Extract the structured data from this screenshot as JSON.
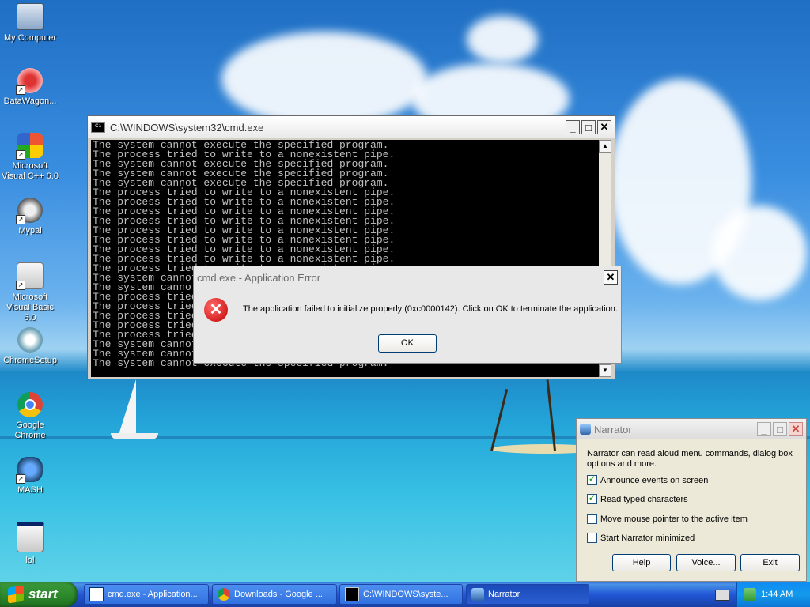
{
  "desktop_icons": [
    {
      "label": "My Computer",
      "icon": "computer-icon"
    },
    {
      "label": "DataWagon...",
      "icon": "datawagon-icon"
    },
    {
      "label": "Microsoft Visual C++ 6.0",
      "icon": "visual-cpp-icon"
    },
    {
      "label": "Mypal",
      "icon": "mypal-icon"
    },
    {
      "label": "Microsoft Visual Basic 6.0",
      "icon": "visual-basic-icon"
    },
    {
      "label": "ChromeSetup",
      "icon": "setup-icon"
    },
    {
      "label": "Google Chrome",
      "icon": "chrome-icon"
    },
    {
      "label": "MASH",
      "icon": "mash-icon"
    },
    {
      "label": "lol",
      "icon": "app-icon"
    }
  ],
  "cmd": {
    "title": "C:\\WINDOWS\\system32\\cmd.exe",
    "icon_text": "C:\\",
    "lines": [
      "The system cannot execute the specified program.",
      "The process tried to write to a nonexistent pipe.",
      "The system cannot execute the specified program.",
      "The system cannot execute the specified program.",
      "The system cannot execute the specified program.",
      "The process tried to write to a nonexistent pipe.",
      "The process tried to write to a nonexistent pipe.",
      "The process tried to write to a nonexistent pipe.",
      "The process tried to write to a nonexistent pipe.",
      "The process tried to write to a nonexistent pipe.",
      "The process tried to write to a nonexistent pipe.",
      "The process tried to write to a nonexistent pipe.",
      "The process tried to write to a nonexistent pipe.",
      "The process tried to write to a nonexistent pipe.",
      "The system cannot execute the specified program.",
      "The system cannot execute the specified program.",
      "The process tried to write to a nonexistent pipe.",
      "The process tried to write to a nonexistent pipe.",
      "The process tried to write to a nonexistent pipe.",
      "The process tried to write to a nonexistent pipe.",
      "The process tried to write to a nonexistent pipe.",
      "The system cannot execute the specified program.",
      "The system cannot execute the specified program.",
      "The system cannot execute the specified program."
    ]
  },
  "error_dialog": {
    "title": "cmd.exe - Application Error",
    "icon": "error-icon",
    "message": "The application failed to initialize properly (0xc0000142). Click on OK to terminate the application.",
    "ok_label": "OK"
  },
  "narrator": {
    "title": "Narrator",
    "description": "Narrator can read aloud menu commands, dialog box options and more.",
    "options": [
      {
        "label": "Announce events on screen",
        "checked": true
      },
      {
        "label": "Read typed characters",
        "checked": true
      },
      {
        "label": "Move mouse pointer to the active item",
        "checked": false
      },
      {
        "label": "Start Narrator minimized",
        "checked": false
      }
    ],
    "help_label": "Help",
    "voice_label": "Voice...",
    "exit_label": "Exit"
  },
  "taskbar": {
    "start_label": "start",
    "items": [
      {
        "label": "cmd.exe - Application...",
        "icon": "app-window-icon"
      },
      {
        "label": "Downloads - Google ...",
        "icon": "chrome-icon"
      },
      {
        "label": "C:\\WINDOWS\\syste...",
        "icon": "cmd-icon"
      },
      {
        "label": "Narrator",
        "icon": "narrator-icon"
      }
    ],
    "clock": "1:44 AM"
  }
}
